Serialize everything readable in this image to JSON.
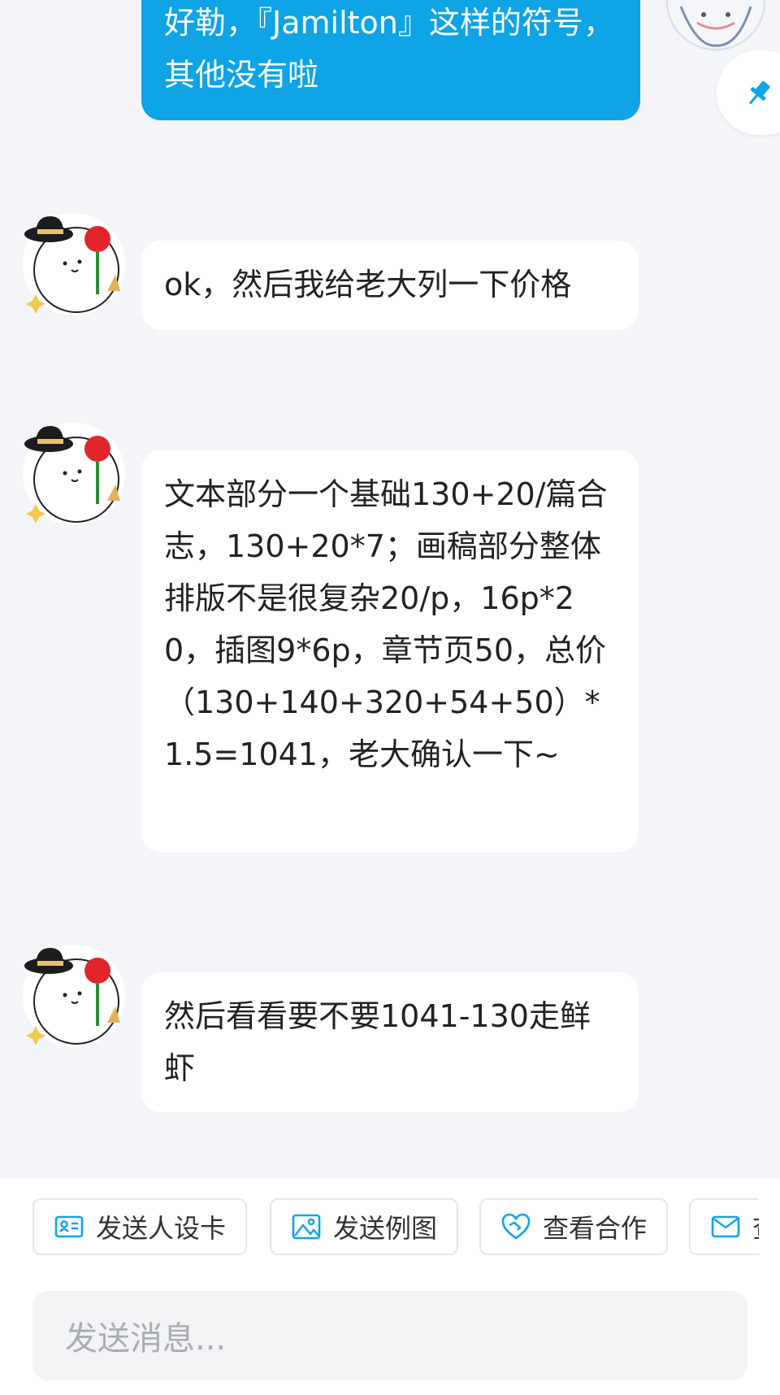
{
  "messages": [
    {
      "from": "self",
      "text": "好勒，『Jamilton』这样的符号，其他没有啦"
    },
    {
      "from": "other",
      "text": "ok，然后我给老大列一下价格"
    },
    {
      "from": "other",
      "text": "文本部分一个基础130+20/篇合志，130+20*7；画稿部分整体排版不是很复杂20/p，16p*20，插图9*6p，章节页50，总价\n（130+140+320+54+50）*1.5=1041，老大确认一下~"
    },
    {
      "from": "other",
      "text": "然后看看要不要1041-130走鲜虾"
    }
  ],
  "quick_actions": [
    {
      "label": "发送人设卡",
      "icon": "id-card-icon"
    },
    {
      "label": "发送例图",
      "icon": "image-icon"
    },
    {
      "label": "查看合作",
      "icon": "heart-handshake-icon"
    },
    {
      "label": "查",
      "icon": "mail-icon"
    }
  ],
  "input": {
    "placeholder": "发送消息..."
  },
  "colors": {
    "accent": "#0ea4e6",
    "background": "#f3f5f8"
  }
}
